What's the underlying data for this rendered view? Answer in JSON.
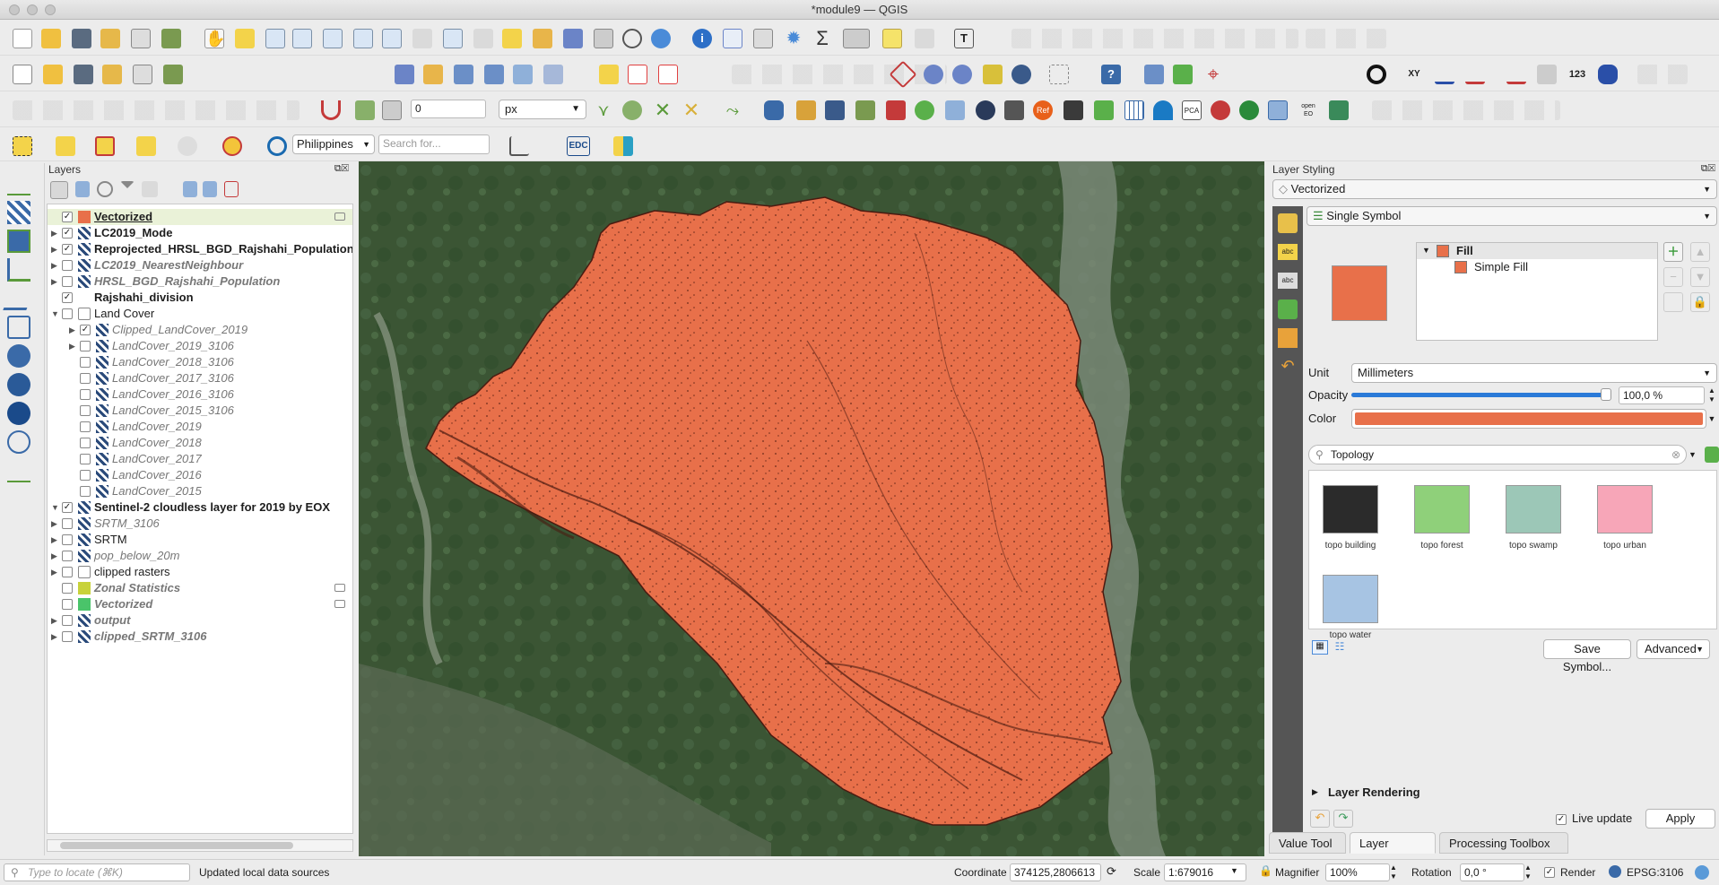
{
  "window": {
    "title": "*module9 — QGIS"
  },
  "toolbar": {
    "snap_tolerance": "0",
    "snap_unit": "px",
    "locator_country": "Philippines",
    "search_placeholder": "Search for...",
    "edc_label": "EDC",
    "openeo_label": "open EO",
    "pca_label": "PCA",
    "ref_label": "Ref",
    "xy_label": "XY",
    "num_label": "123"
  },
  "layers_panel": {
    "title": "Layers",
    "items": [
      {
        "name": "Vectorized",
        "checked": true,
        "style": "bold"
      },
      {
        "name": "LC2019_Mode",
        "checked": true,
        "style": "bold"
      },
      {
        "name": "Reprojected_HRSL_BGD_Rajshahi_Population",
        "checked": true,
        "style": "bold"
      },
      {
        "name": "LC2019_NearestNeighbour",
        "checked": false,
        "style": "italic"
      },
      {
        "name": "HRSL_BGD_Rajshahi_Population",
        "checked": false,
        "style": "italic"
      },
      {
        "name": "Rajshahi_division",
        "checked": true,
        "style": "bold"
      },
      {
        "name": "Land Cover",
        "checked": false,
        "style": "normal"
      },
      {
        "name": "Clipped_LandCover_2019",
        "checked": true,
        "style": "italic"
      },
      {
        "name": "LandCover_2019_3106",
        "checked": false,
        "style": "italic"
      },
      {
        "name": "LandCover_2018_3106",
        "checked": false,
        "style": "italic"
      },
      {
        "name": "LandCover_2017_3106",
        "checked": false,
        "style": "italic"
      },
      {
        "name": "LandCover_2016_3106",
        "checked": false,
        "style": "italic"
      },
      {
        "name": "LandCover_2015_3106",
        "checked": false,
        "style": "italic"
      },
      {
        "name": "LandCover_2019",
        "checked": false,
        "style": "italic"
      },
      {
        "name": "LandCover_2018",
        "checked": false,
        "style": "italic"
      },
      {
        "name": "LandCover_2017",
        "checked": false,
        "style": "italic"
      },
      {
        "name": "LandCover_2016",
        "checked": false,
        "style": "italic"
      },
      {
        "name": "LandCover_2015",
        "checked": false,
        "style": "italic"
      },
      {
        "name": "Sentinel-2 cloudless layer for 2019 by EOX",
        "checked": true,
        "style": "bold"
      },
      {
        "name": "SRTM_3106",
        "checked": false,
        "style": "italic"
      },
      {
        "name": "SRTM",
        "checked": false,
        "style": "normal"
      },
      {
        "name": "pop_below_20m",
        "checked": false,
        "style": "italic"
      },
      {
        "name": "clipped rasters",
        "checked": false,
        "style": "normal"
      },
      {
        "name": "Zonal Statistics",
        "checked": false,
        "style": "italic"
      },
      {
        "name": "Vectorized",
        "checked": false,
        "style": "italic"
      },
      {
        "name": "output",
        "checked": false,
        "style": "italic"
      },
      {
        "name": "clipped_SRTM_3106",
        "checked": false,
        "style": "italic"
      }
    ]
  },
  "styling_panel": {
    "title": "Layer Styling",
    "layer": "Vectorized",
    "renderer": "Single Symbol",
    "symbol_tree": {
      "root": "Fill",
      "child": "Simple Fill"
    },
    "unit_label": "Unit",
    "unit_value": "Millimeters",
    "opacity_label": "Opacity",
    "opacity_value": "100,0 %",
    "opacity_fraction": 1.0,
    "color_label": "Color",
    "fill_color": "#e8704a",
    "library_search": "Topology",
    "symbols": [
      {
        "name": "topo building",
        "color": "#2b2b2b"
      },
      {
        "name": "topo forest",
        "color": "#8fd07a"
      },
      {
        "name": "topo swamp",
        "color": "#9cc7b7"
      },
      {
        "name": "topo urban",
        "color": "#f7a6b8"
      },
      {
        "name": "topo water",
        "color": "#a7c4e3"
      }
    ],
    "save_symbol": "Save Symbol...",
    "advanced": "Advanced",
    "layer_rendering": "Layer Rendering",
    "live_update_label": "Live update",
    "live_update": true,
    "apply": "Apply"
  },
  "dock_tabs": [
    "Value Tool",
    "Layer Styling",
    "Processing Toolbox"
  ],
  "statusbar": {
    "locate_placeholder": "Type to locate (⌘K)",
    "message": "Updated local data sources",
    "coordinate_label": "Coordinate",
    "coordinate_value": "374125,2806613",
    "scale_label": "Scale",
    "scale_value": "1:679016",
    "magnifier_label": "Magnifier",
    "magnifier_value": "100%",
    "rotation_label": "Rotation",
    "rotation_value": "0,0 °",
    "render_label": "Render",
    "render_checked": true,
    "crs": "EPSG:3106"
  }
}
